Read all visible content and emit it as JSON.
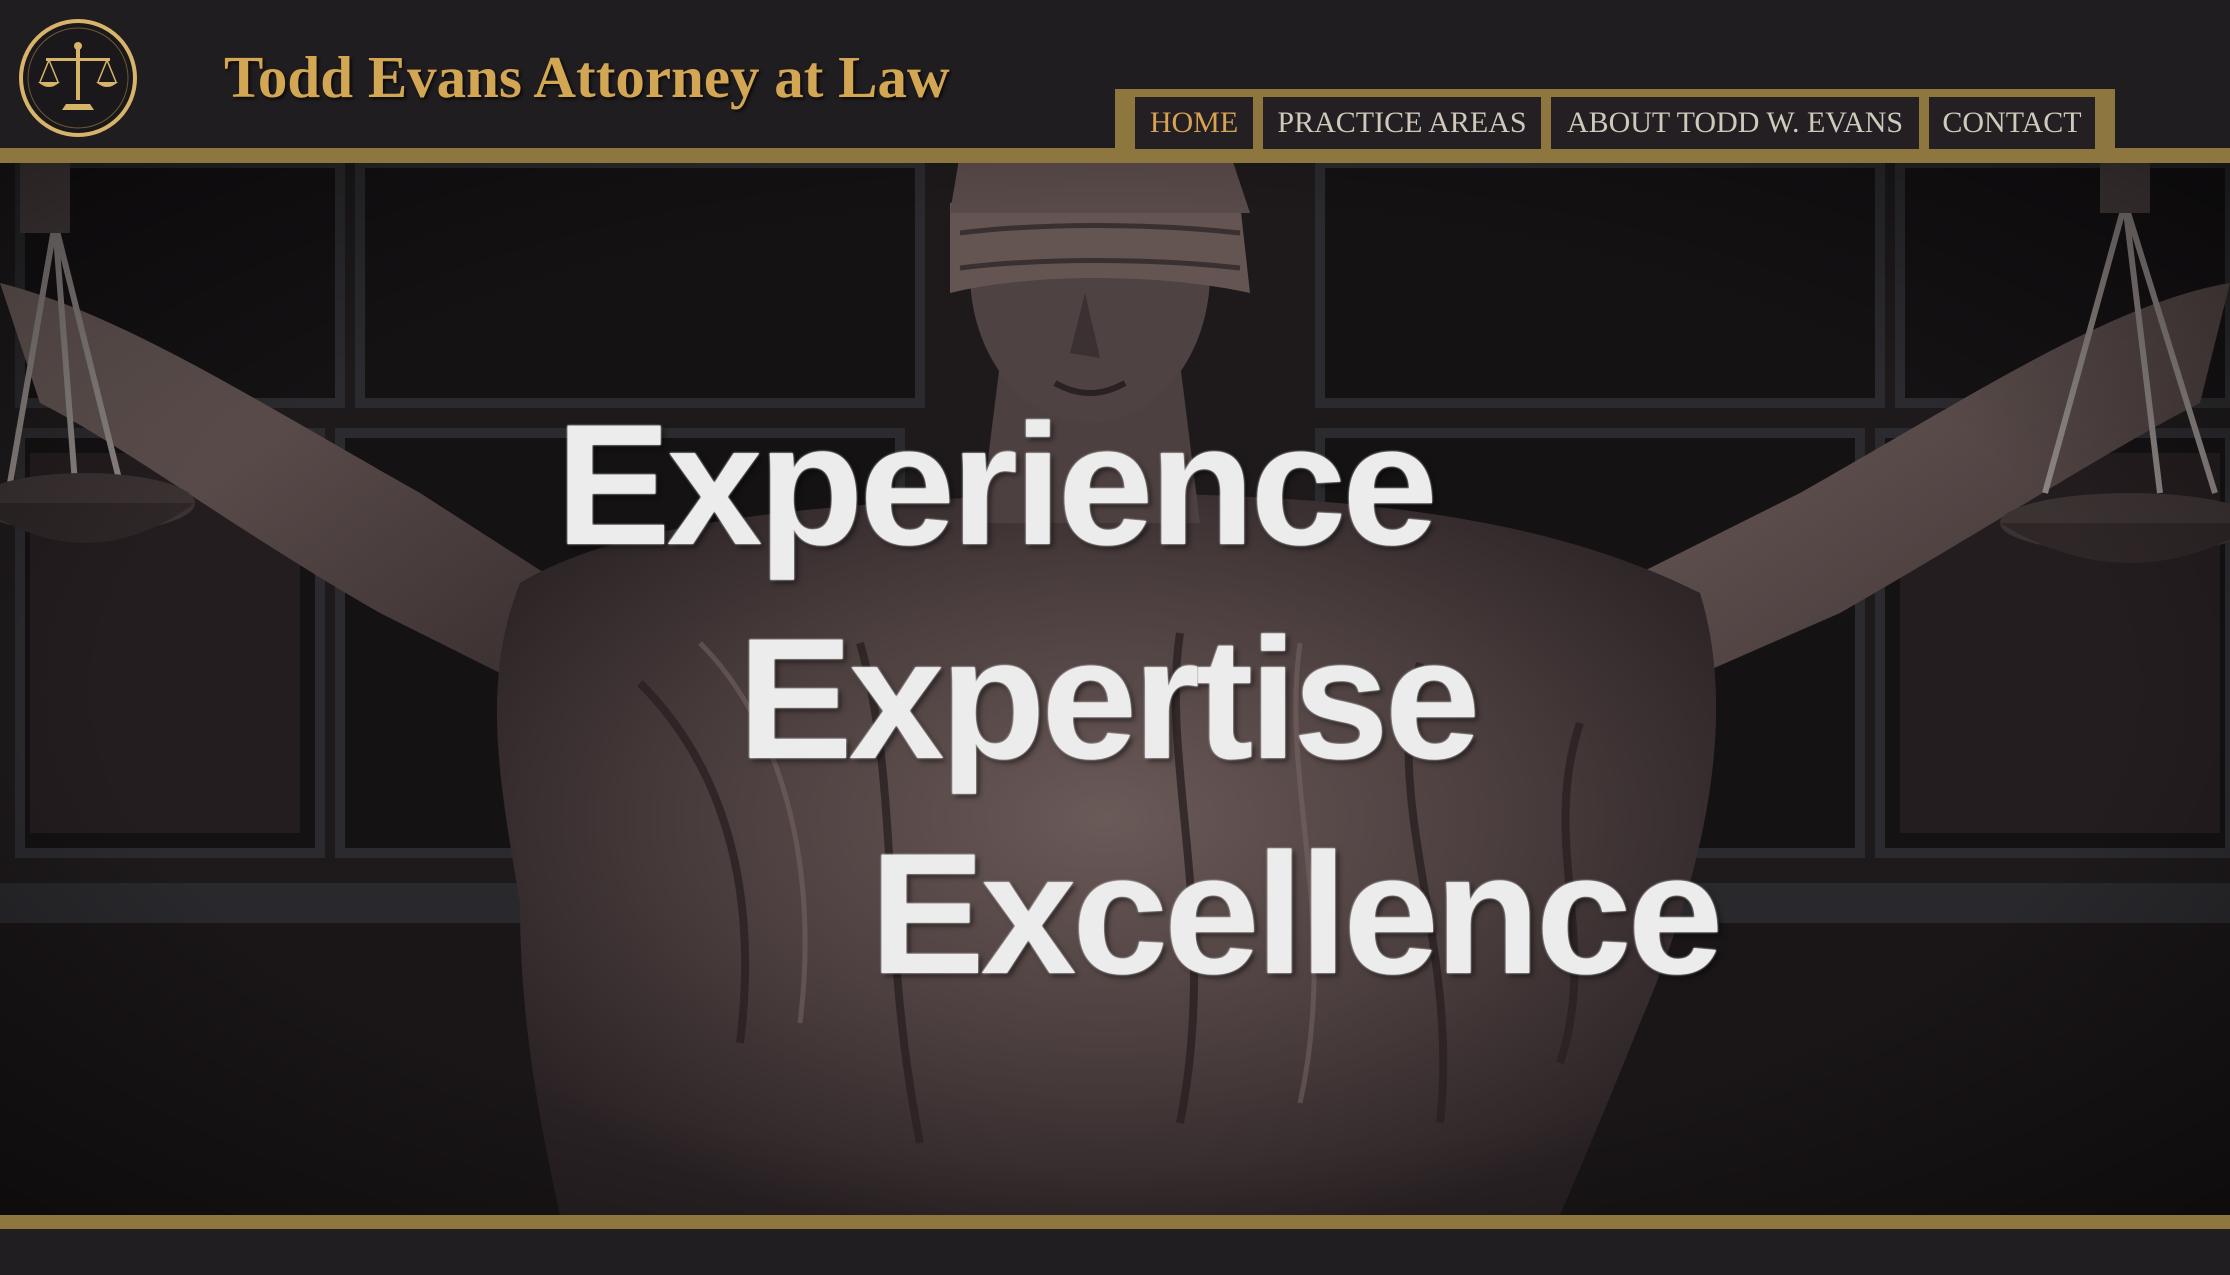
{
  "header": {
    "title": "Todd Evans Attorney at Law",
    "logo_icon": "scales-of-justice-icon"
  },
  "nav": {
    "items": [
      {
        "label": "HOME",
        "active": true
      },
      {
        "label": "PRACTICE AREAS",
        "active": false
      },
      {
        "label": "ABOUT TODD W. EVANS",
        "active": false
      },
      {
        "label": "CONTACT",
        "active": false
      }
    ]
  },
  "hero": {
    "image": "lady-justice-statue",
    "taglines": [
      "Experience",
      "Expertise",
      "Excellence"
    ]
  },
  "colors": {
    "background": "#201d20",
    "gold": "#8d773e",
    "title_gold": "#d2a652",
    "nav_text": "#cfc8bb",
    "nav_active": "#d7a252",
    "tagline": "#ececec"
  }
}
